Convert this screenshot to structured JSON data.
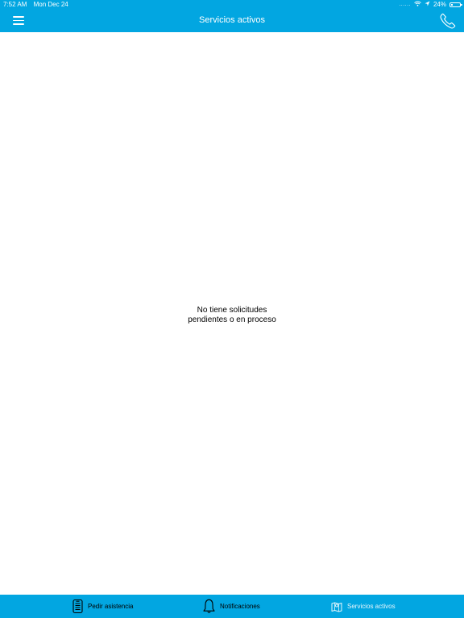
{
  "status_bar": {
    "time": "7:52 AM",
    "date": "Mon Dec 24",
    "signal": "......",
    "battery_percent_label": "24%",
    "battery_level": 0.24
  },
  "header": {
    "title": "Servicios activos"
  },
  "main": {
    "empty_line_1": "No tiene solicitudes",
    "empty_line_2": "pendientes o en proceso"
  },
  "tabbar": {
    "tabs": [
      {
        "label": "Pedir asistencia",
        "icon": "phone-device-icon"
      },
      {
        "label": "Notificaciones",
        "icon": "bell-icon"
      },
      {
        "label": "Servicios activos",
        "icon": "map-icon"
      }
    ],
    "active_tab": "Servicios activos"
  },
  "colors": {
    "primary": "#02a6e1",
    "background": "#ffffff",
    "text": "#000000"
  }
}
